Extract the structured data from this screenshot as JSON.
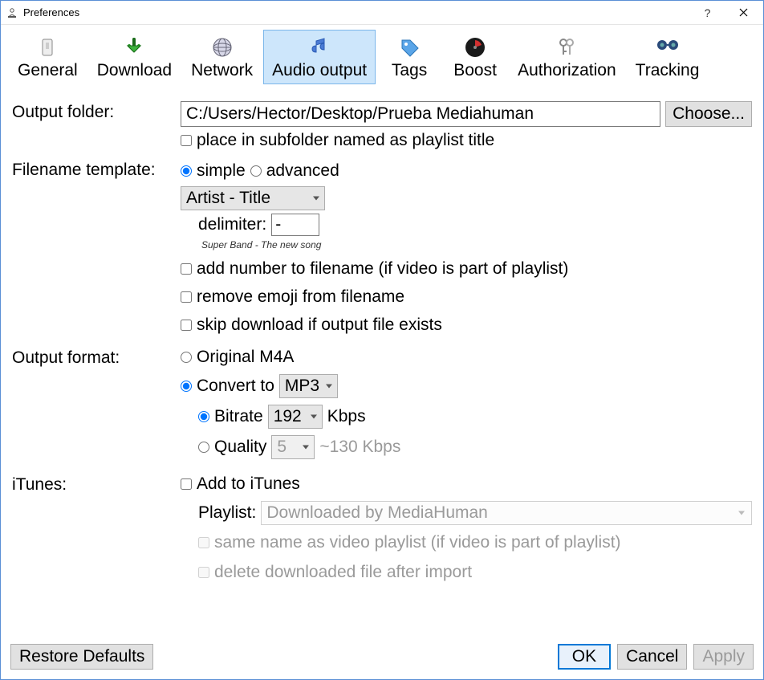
{
  "window": {
    "title": "Preferences"
  },
  "tabs": {
    "general": "General",
    "download": "Download",
    "network": "Network",
    "audio_output": "Audio output",
    "tags": "Tags",
    "boost": "Boost",
    "authorization": "Authorization",
    "tracking": "Tracking",
    "active": "audio_output"
  },
  "output_folder": {
    "label": "Output folder:",
    "path": "C:/Users/Hector/Desktop/Prueba Mediahuman",
    "choose_label": "Choose...",
    "subfolder_checkbox": "place in subfolder named as playlist title",
    "subfolder_checked": false
  },
  "filename_template": {
    "label": "Filename template:",
    "mode_simple": "simple",
    "mode_advanced": "advanced",
    "mode_selected": "simple",
    "template_value": "Artist - Title",
    "delimiter_label": "delimiter:",
    "delimiter_value": "-",
    "example": "Super Band - The new song",
    "add_number": "add number to filename (if video is part of playlist)",
    "add_number_checked": false,
    "remove_emoji": "remove emoji from filename",
    "remove_emoji_checked": false,
    "skip_exists": "skip download if output file exists",
    "skip_exists_checked": false
  },
  "output_format": {
    "label": "Output format:",
    "original_label": "Original M4A",
    "convert_label": "Convert to",
    "selected": "convert",
    "convert_format": "MP3",
    "bitrate_label": "Bitrate",
    "bitrate_value": "192",
    "bitrate_unit": "Kbps",
    "bitrate_selected": true,
    "quality_label": "Quality",
    "quality_value": "5",
    "quality_hint": "~130 Kbps"
  },
  "itunes": {
    "label": "iTunes:",
    "add_label": "Add to iTunes",
    "add_checked": false,
    "playlist_label": "Playlist:",
    "playlist_value": "Downloaded by MediaHuman",
    "same_name": "same name as video playlist (if video is part of playlist)",
    "delete_after": "delete downloaded file after import"
  },
  "footer": {
    "restore": "Restore Defaults",
    "ok": "OK",
    "cancel": "Cancel",
    "apply": "Apply"
  }
}
